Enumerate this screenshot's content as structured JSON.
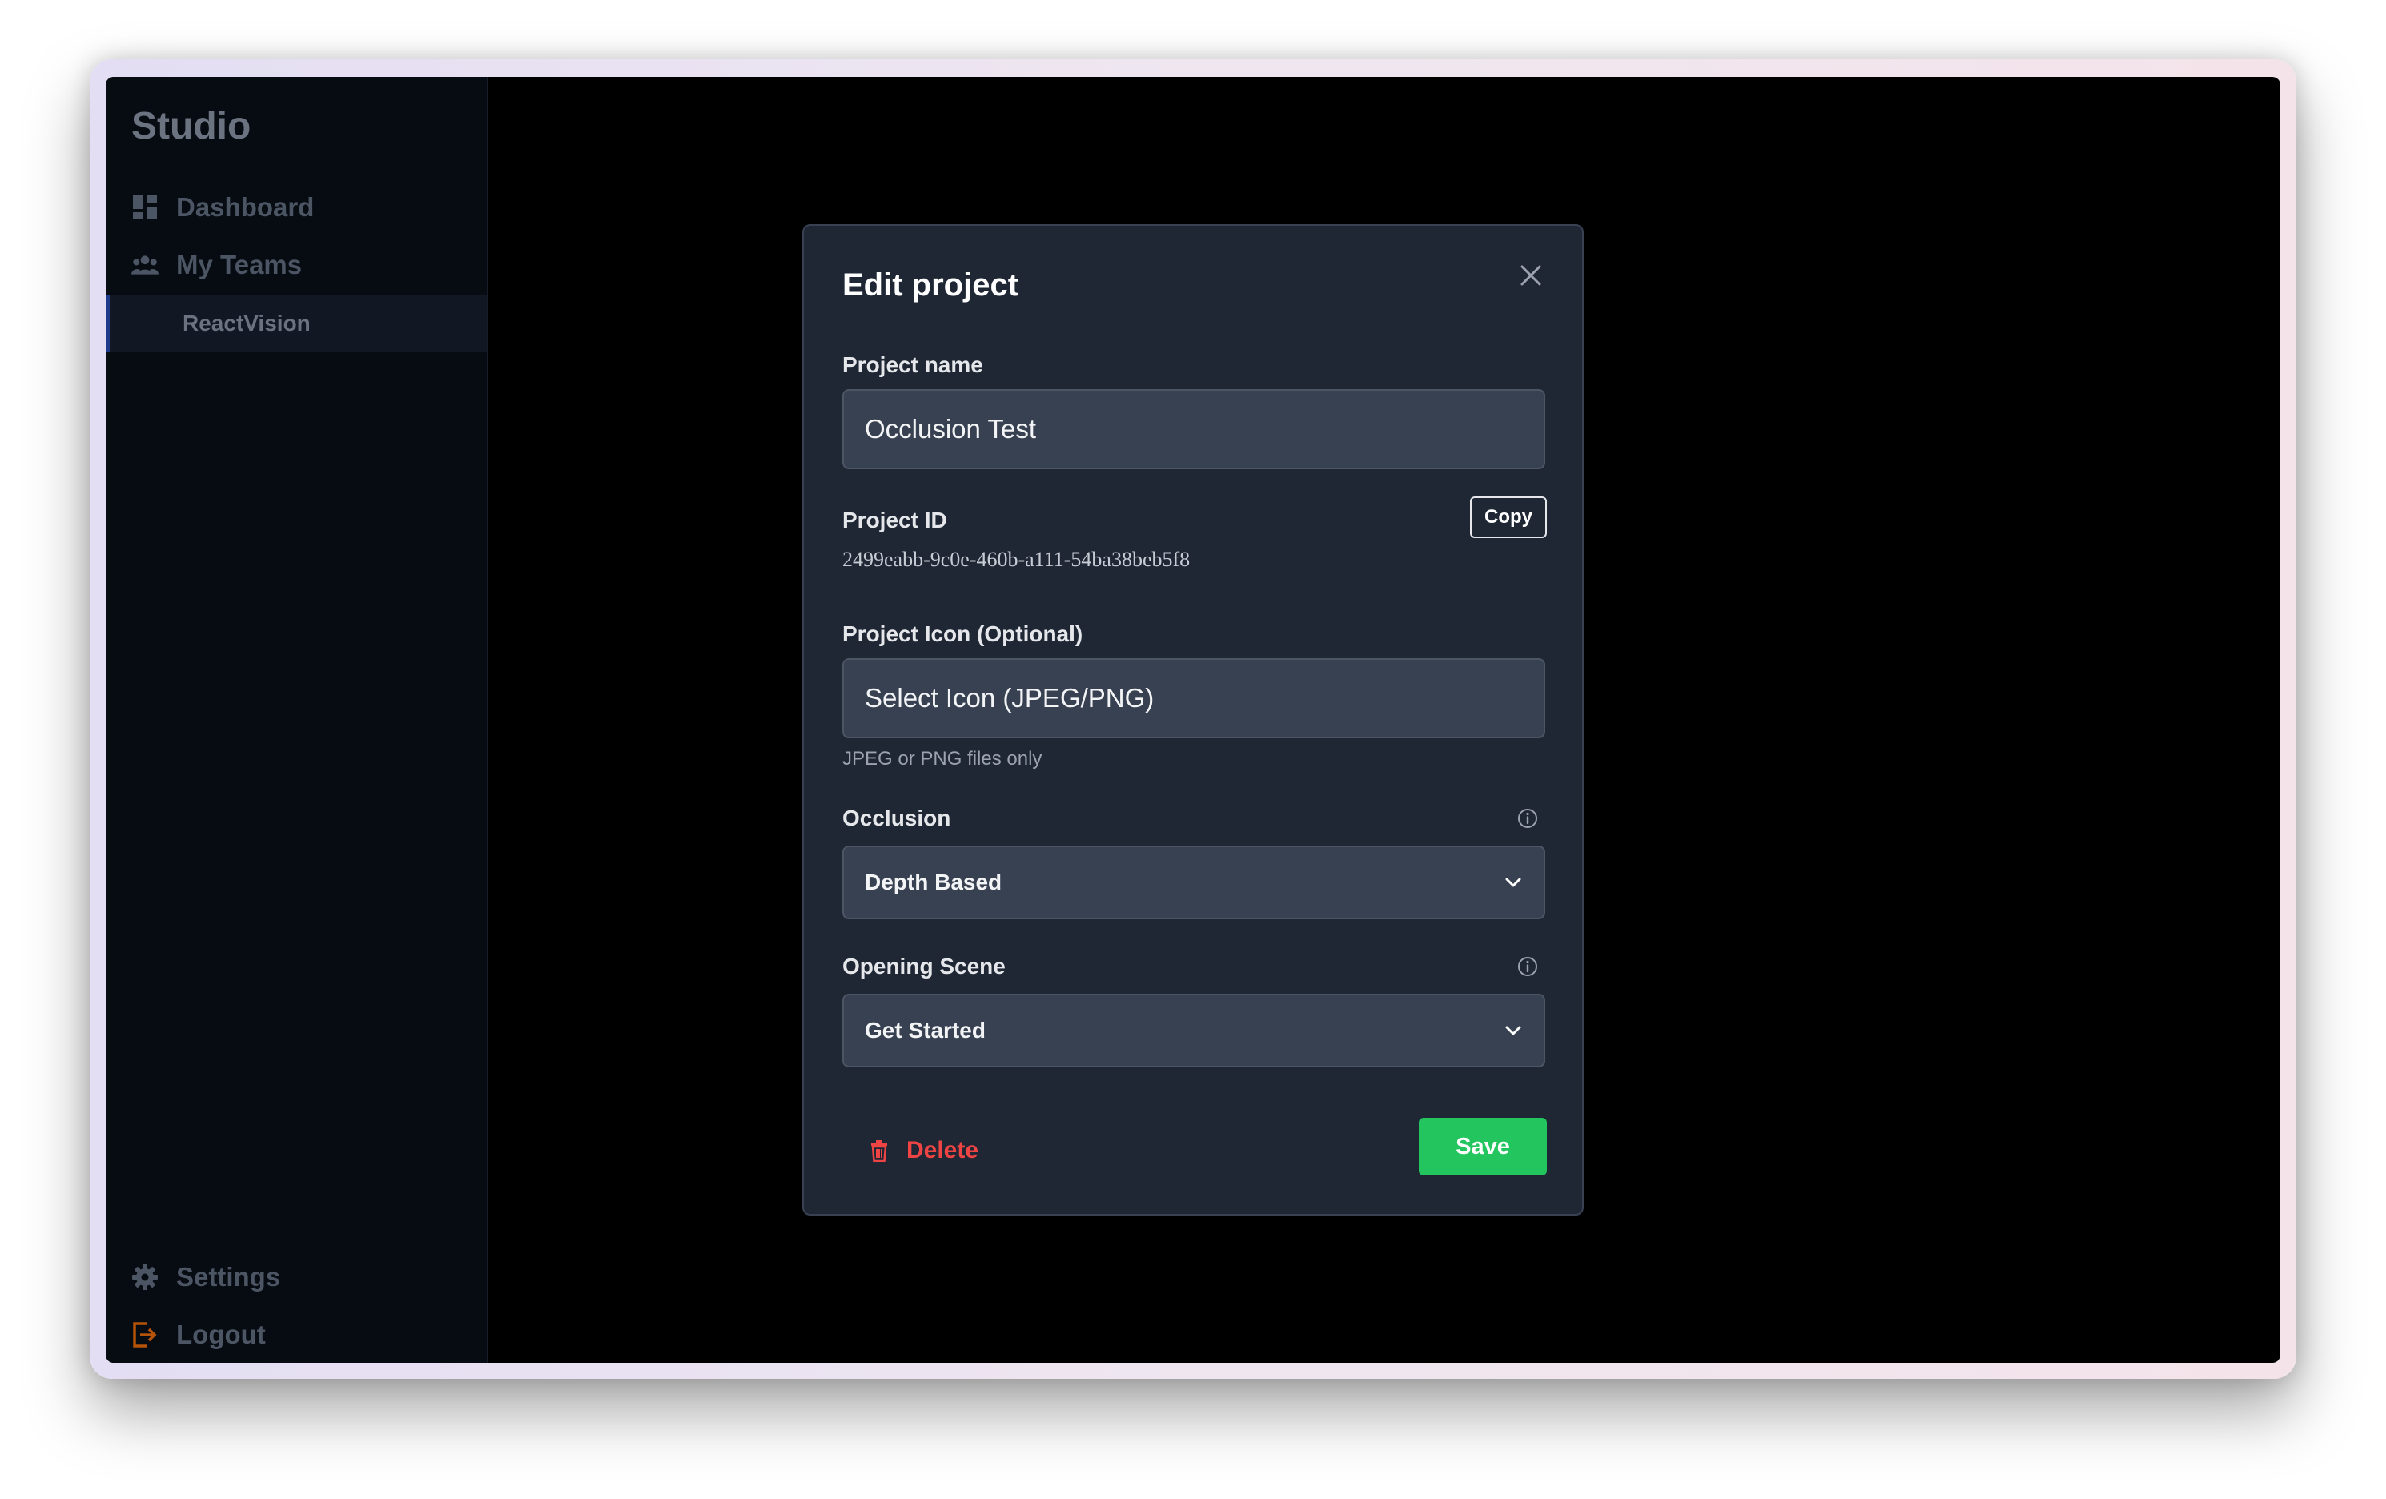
{
  "sidebar": {
    "brand": "Studio",
    "items": [
      {
        "label": "Dashboard",
        "icon": "dashboard-icon"
      },
      {
        "label": "My Teams",
        "icon": "teams-icon"
      }
    ],
    "sub_items": [
      {
        "label": "ReactVision",
        "active": true
      }
    ],
    "bottom_items": [
      {
        "label": "Settings",
        "icon": "gear-icon"
      },
      {
        "label": "Logout",
        "icon": "logout-icon"
      }
    ]
  },
  "modal": {
    "title": "Edit project",
    "project_name": {
      "label": "Project name",
      "value": "Occlusion Test"
    },
    "project_id": {
      "label": "Project ID",
      "value": "2499eabb-9c0e-460b-a111-54ba38beb5f8",
      "copy_label": "Copy"
    },
    "project_icon": {
      "label": "Project Icon (Optional)",
      "button_label": "Select Icon (JPEG/PNG)",
      "hint": "JPEG or PNG files only"
    },
    "occlusion": {
      "label": "Occlusion",
      "selected": "Depth Based"
    },
    "opening_scene": {
      "label": "Opening Scene",
      "selected": "Get Started"
    },
    "delete_label": "Delete",
    "save_label": "Save"
  },
  "colors": {
    "accent_green": "#22c55e",
    "danger_red": "#ef4444",
    "modal_bg": "#1f2735",
    "field_bg": "#374151",
    "logout_icon": "#b45309"
  }
}
